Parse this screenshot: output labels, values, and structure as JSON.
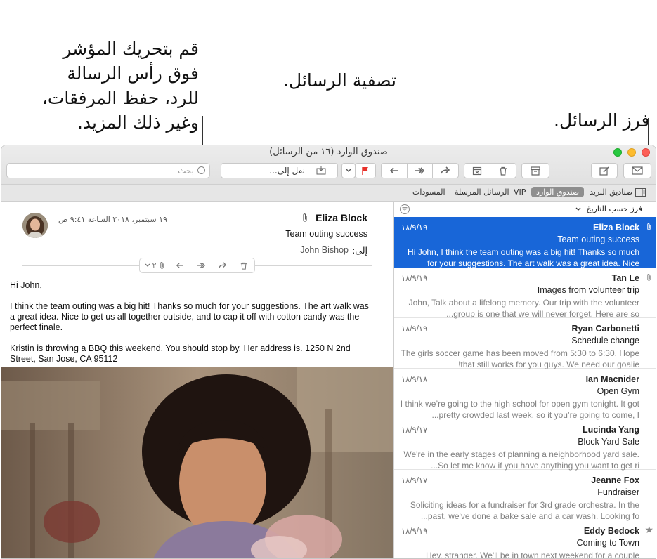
{
  "callouts": {
    "reply_lines": [
      "قم بتحريك المؤشر",
      "فوق رأس الرسالة",
      "للرد، حفظ المرفقات،",
      "وغير ذلك المزيد."
    ],
    "filter": "تصفية الرسائل.",
    "sort": "فرز الرسائل."
  },
  "window": {
    "title": "صندوق الوارد (١٦ من الرسائل)"
  },
  "toolbar": {
    "search_placeholder": "بحث",
    "move_to_label": "نقل إلى..."
  },
  "favorites": {
    "mailboxes": "صناديق البريد",
    "inbox": "صندوق الوارد",
    "vip": "VIP",
    "sent": "الرسائل المرسلة",
    "drafts": "المسودات"
  },
  "list": {
    "sort_label": "فرز حسب التاريخ",
    "messages": [
      {
        "sender": "Eliza Block",
        "date": "١٨/٩/١٩",
        "subject": "Team outing success",
        "preview": "Hi John, I think the team outing was a big hit! Thanks so much for your suggestions. The art walk was a great idea. Nice",
        "selected": true,
        "attachment": true,
        "flag": false
      },
      {
        "sender": "Tan Le",
        "date": "١٨/٩/١٩",
        "subject": "Images from volunteer trip",
        "preview": "John, Talk about a lifelong memory. Our trip with the volunteer group is one that we will never forget. Here are so...",
        "selected": false,
        "attachment": true,
        "flag": false
      },
      {
        "sender": "Ryan Carbonetti",
        "date": "١٨/٩/١٩",
        "subject": "Schedule change",
        "preview": "The girls soccer game has been moved from 5:30 to 6:30. Hope that still works for you guys. We need our goalie!",
        "selected": false,
        "attachment": false,
        "flag": false
      },
      {
        "sender": "Ian Macnider",
        "date": "١٨/٩/١٨",
        "subject": "Open Gym",
        "preview": "I think we’re going to the high school for open gym tonight. It got pretty crowded last week, so it you’re going to come, I...",
        "selected": false,
        "attachment": false,
        "flag": false
      },
      {
        "sender": "Lucinda Yang",
        "date": "١٨/٩/١٧",
        "subject": "Block Yard Sale",
        "preview": "We're in the early stages of planning a neighborhood yard sale. So let me know if you have anything you want to get ri...",
        "selected": false,
        "attachment": false,
        "flag": false
      },
      {
        "sender": "Jeanne Fox",
        "date": "١٨/٩/١٧",
        "subject": "Fundraiser",
        "preview": "Soliciting ideas for a fundraiser for 3rd grade orchestra. In the past, we've done a bake sale and a car wash. Looking fo...",
        "selected": false,
        "attachment": false,
        "flag": false
      },
      {
        "sender": "Eddy Bedock",
        "date": "١٨/٩/١٩",
        "subject": "Coming to Town",
        "preview": "Hey, stranger. We'll be in town next weekend for a couple",
        "selected": false,
        "attachment": false,
        "flag": true
      }
    ]
  },
  "reader": {
    "from": "Eliza Block",
    "subject": "Team outing success",
    "to_label": "إلى:",
    "to": "John Bishop",
    "date": "١٩ سبتمبر، ٢٠١٨ الساعة ٩:٤١ ص",
    "attachment_count": "٢",
    "body": [
      "Hi John,",
      "I think the team outing was a big hit! Thanks so much for your suggestions. The art walk was a great idea. Nice to get us all together outside, and to cap it off with cotton candy was the perfect finale.",
      "Kristin is throwing a BBQ this weekend. You should stop by. Her address is. 1250 N 2nd Street, San Jose, CA 95112"
    ]
  },
  "icons": {
    "close": "close-window-icon",
    "flag_color": "#e8322b",
    "selection_color": "#1866d8"
  }
}
